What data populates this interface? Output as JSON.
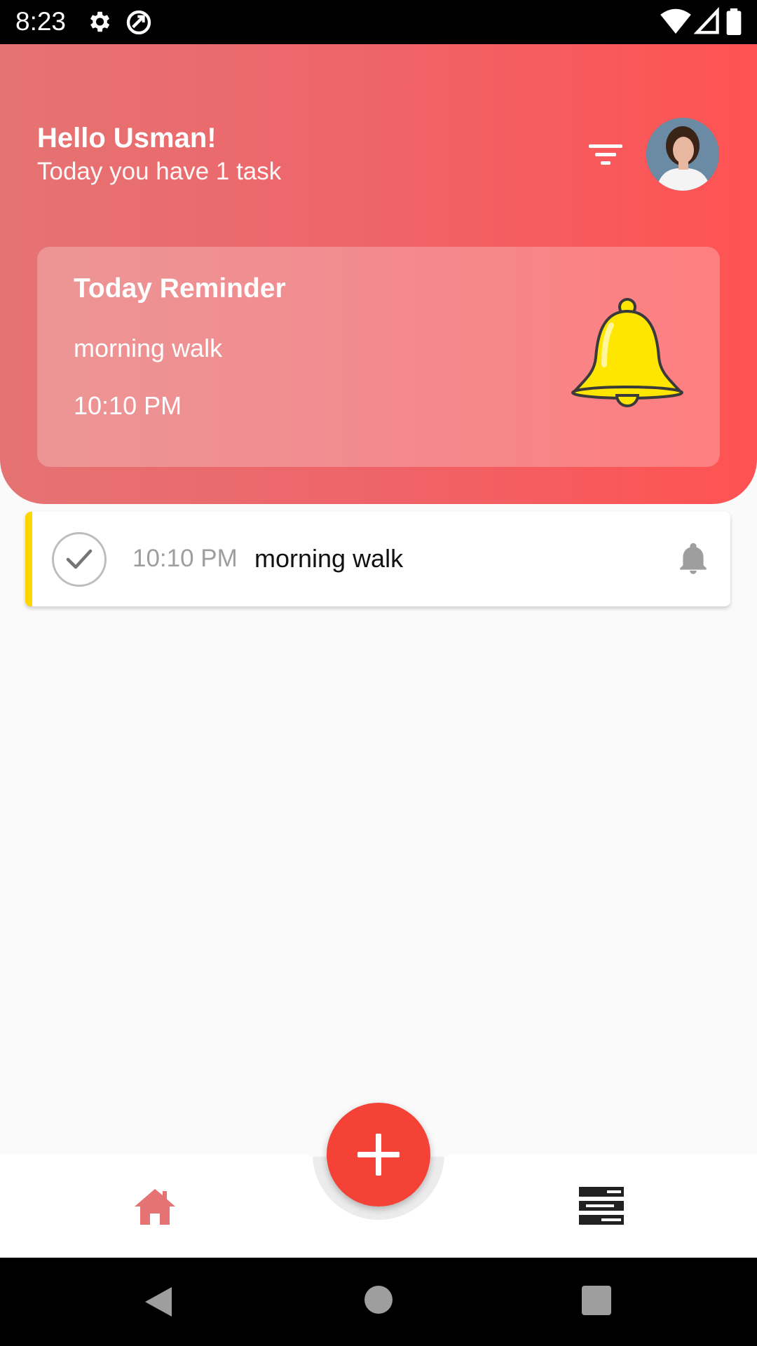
{
  "status_bar": {
    "time": "8:23",
    "icons": [
      "settings-icon",
      "sync-icon",
      "wifi-icon",
      "signal-icon",
      "battery-icon"
    ]
  },
  "header": {
    "greeting_title": "Hello Usman!",
    "greeting_subtitle": "Today you have 1 task",
    "filter_icon": "filter-icon",
    "avatar_icon": "user-avatar",
    "gradient_colors": [
      "#e57373",
      "#ff5252"
    ]
  },
  "reminder_card": {
    "title": "Today Reminder",
    "task": "morning walk",
    "time": "10:10 PM",
    "icon": "bell-icon",
    "icon_color": "#ffe600"
  },
  "tasks": [
    {
      "time": "10:10 PM",
      "name": "morning walk",
      "accent_color": "#ffd600",
      "status_icon": "check-icon",
      "alarm_icon": "bell-icon"
    }
  ],
  "bottom_nav": {
    "items": [
      {
        "icon": "home-icon",
        "color": "#e57373"
      },
      {
        "icon": "list-icon",
        "color": "#212121"
      }
    ],
    "fab_icon": "plus-icon",
    "fab_color": "#f44336"
  },
  "system_nav": {
    "icons": [
      "back-icon",
      "home-circle-icon",
      "recents-icon"
    ]
  }
}
